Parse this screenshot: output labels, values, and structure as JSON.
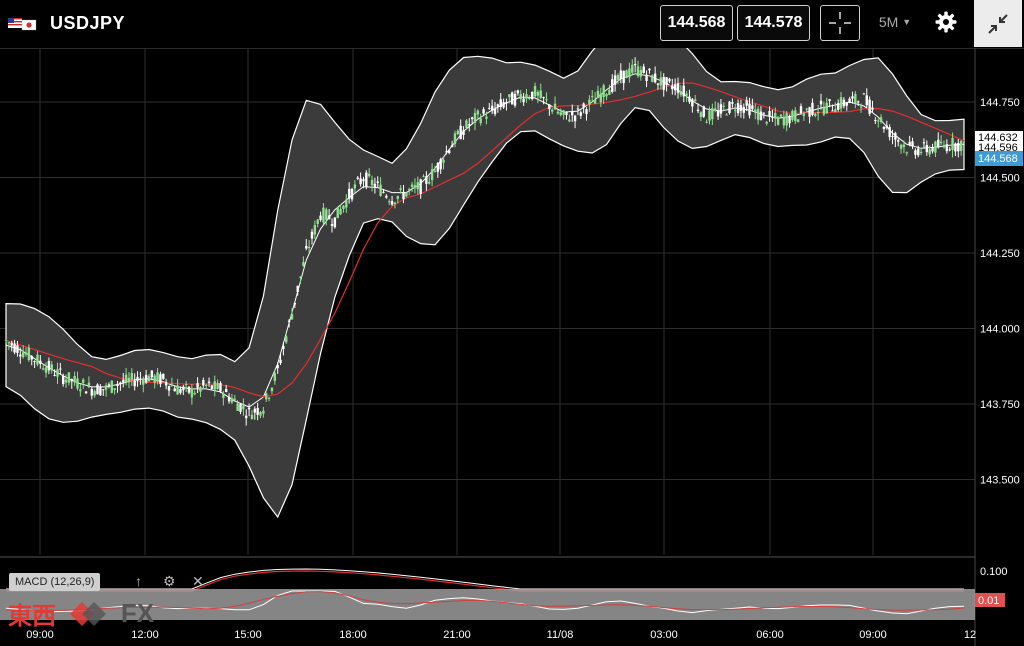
{
  "header": {
    "symbol": "USDJPY",
    "bid": "144.568",
    "ask": "144.578",
    "timeframe": "5M"
  },
  "icons": {
    "flags": "us-jp-flags-icon",
    "crosshair": "crosshair-icon",
    "settings": "gear-icon",
    "minimize": "minimize-icon",
    "dropdown": "chevron-down-icon"
  },
  "colors": {
    "background": "#000000",
    "band_fill": "#3b3b3b",
    "band_line": "#ffffff",
    "ma_line": "#e03030",
    "up_candle": "#8ee08e",
    "price_badge": "#3d9bd6",
    "macd_badge": "#e05050"
  },
  "price_axis": {
    "ticks": [
      "144.750",
      "144.500",
      "144.250",
      "144.000",
      "143.750",
      "143.500"
    ],
    "labels": {
      "label_a": "144.632",
      "label_b": "144.596",
      "current": "144.568"
    }
  },
  "time_axis": {
    "ticks": [
      "09:00",
      "12:00",
      "15:00",
      "18:00",
      "21:00",
      "11/08",
      "03:00",
      "06:00",
      "09:00",
      "12"
    ]
  },
  "macd": {
    "label": "MACD (12,26,9)",
    "tick": "0.100",
    "badge": "0.01",
    "up_icon": "up-arrow-icon",
    "settings_icon": "gear-icon",
    "close_icon": "close-icon"
  },
  "watermark": {
    "cjk": "東西",
    "fx": "FX"
  },
  "chart_data": {
    "type": "candlestick",
    "ylim": [
      143.4,
      144.95
    ],
    "grid": true,
    "close_profile": [
      143.96,
      143.93,
      143.9,
      143.87,
      143.84,
      143.82,
      143.8,
      143.8,
      143.82,
      143.83,
      143.84,
      143.83,
      143.8,
      143.79,
      143.81,
      143.8,
      143.76,
      143.72,
      143.74,
      143.86,
      144.05,
      144.25,
      144.38,
      144.36,
      144.44,
      144.5,
      144.47,
      144.43,
      144.45,
      144.47,
      144.52,
      144.6,
      144.66,
      144.7,
      144.72,
      144.75,
      144.77,
      144.78,
      144.74,
      144.7,
      144.71,
      144.75,
      144.79,
      144.83,
      144.86,
      144.84,
      144.81,
      144.8,
      144.76,
      144.7,
      144.72,
      144.74,
      144.73,
      144.7,
      144.69,
      144.7,
      144.72,
      144.73,
      144.74,
      144.75,
      144.76,
      144.7,
      144.64,
      144.6,
      144.59,
      144.6,
      144.61,
      144.61
    ]
  }
}
